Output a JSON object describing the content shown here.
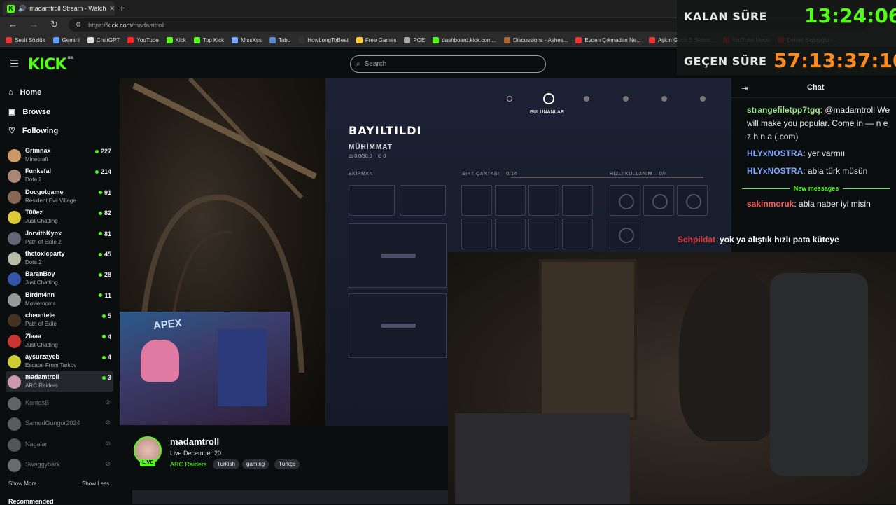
{
  "browser": {
    "tab_title": "madamtroll Stream - Watch",
    "url_prefix": "https://",
    "url_host": "kick.com",
    "url_path": "/madamtroll",
    "bookmarks": [
      {
        "label": "Sesli Sözlük",
        "color": "#e33"
      },
      {
        "label": "Gemini",
        "color": "#5b9cff"
      },
      {
        "label": "ChatGPT",
        "color": "#ddd"
      },
      {
        "label": "YouTube",
        "color": "#f22"
      },
      {
        "label": "Kick",
        "color": "#53fc18"
      },
      {
        "label": "Top Kick",
        "color": "#53fc18"
      },
      {
        "label": "MissXss",
        "color": "#7af"
      },
      {
        "label": "Tabu",
        "color": "#58c"
      },
      {
        "label": "HowLongToBeat",
        "color": "#333"
      },
      {
        "label": "Free Games",
        "color": "#fc3"
      },
      {
        "label": "POE",
        "color": "#aaa"
      },
      {
        "label": "dashboard.kick.com...",
        "color": "#53fc18"
      },
      {
        "label": "Discussions - Ashes...",
        "color": "#a63"
      },
      {
        "label": "Evden Çıkmadan Ne...",
        "color": "#e33"
      },
      {
        "label": "Aşkın Gücü 3. Sezon...",
        "color": "#e33"
      },
      {
        "label": "YouTube Music",
        "color": "#f22"
      },
      {
        "label": "Demet Sağıroğlu -...",
        "color": "#f22"
      }
    ]
  },
  "kick": {
    "logo": "KICK",
    "logo_sup": "BETA",
    "search_placeholder": "Search",
    "nav": {
      "home": "Home",
      "browse": "Browse",
      "following": "Following"
    },
    "channels": [
      {
        "name": "Grimnax",
        "game": "Minecraft",
        "viewers": "227",
        "color": "#c96"
      },
      {
        "name": "Funkefal",
        "game": "Dota 2",
        "viewers": "214",
        "color": "#a87"
      },
      {
        "name": "Docgotgame",
        "game": "Resident Evil Village",
        "viewers": "91",
        "color": "#865"
      },
      {
        "name": "T00ez",
        "game": "Just Chatting",
        "viewers": "82",
        "color": "#dc3"
      },
      {
        "name": "JorvithKynx",
        "game": "Path of Exile 2",
        "viewers": "81",
        "color": "#667"
      },
      {
        "name": "thetoxicparty",
        "game": "Dota 2",
        "viewers": "45",
        "color": "#bba"
      },
      {
        "name": "BaranBoy",
        "game": "Just Chatting",
        "viewers": "28",
        "color": "#35a"
      },
      {
        "name": "Birdm4nn",
        "game": "Movierooms",
        "viewers": "11",
        "color": "#999"
      },
      {
        "name": "cheontele",
        "game": "Path of Exile",
        "viewers": "5",
        "color": "#432"
      },
      {
        "name": "Zlaaa",
        "game": "Just Chatting",
        "viewers": "4",
        "color": "#c33"
      },
      {
        "name": "aysurzayeb",
        "game": "Escape From Tarkov",
        "viewers": "4",
        "color": "#cc3"
      },
      {
        "name": "madamtroll",
        "game": "ARC Raiders",
        "viewers": "3",
        "color": "#c9a"
      }
    ],
    "offline_channels": [
      {
        "name": "KontesB",
        "color": "#ccc"
      },
      {
        "name": "SamedGungor2024",
        "color": "#bbb"
      },
      {
        "name": "Nagalar",
        "color": "#aaa"
      },
      {
        "name": "Swaggybark",
        "color": "#ddd"
      }
    ],
    "show_more": "Show More",
    "show_less": "Show Less",
    "recommended": "Recommended",
    "streamer": {
      "name": "madamtroll",
      "live_since": "Live December 20",
      "category": "ARC Raiders",
      "tags": [
        "Turkish",
        "gaming",
        "Türkçe"
      ],
      "live_badge": "LIVE"
    },
    "chat": {
      "title": "Chat",
      "messages": [
        {
          "user": "strangefiletpp7tgq",
          "user_color": "#9be48a",
          "text": "@madamtroll We will make you popular. Come in — n e z h n a (.com)"
        },
        {
          "user": "HLYxNOSTRA",
          "user_color": "#7fa6ff",
          "text": "yer varmıı"
        },
        {
          "user": "HLYxNOSTRA",
          "user_color": "#7fa6ff",
          "text": "abla türk müsün"
        },
        {
          "user": "sakinmoruk",
          "user_color": "#ff5858",
          "text": "abla naber iyi misin"
        }
      ],
      "new_messages": "New messages"
    }
  },
  "game": {
    "tab_label": "BULUNANLAR",
    "status": "BAYILTILDI",
    "ammo_label": "MÜHİMMAT",
    "ammo_value": "0.0/30.0",
    "ammo_count": "0",
    "equipment": "EKİPMAN",
    "backpack": "SIRT ÇANTASI",
    "backpack_count": "0/14",
    "quick_use": "HIZLI KULLANIM",
    "quick_count": "0/4",
    "webcam_sign": "APEX"
  },
  "overlay": {
    "remaining_label": "KALAN SÜRE",
    "remaining_value": "13:24:06",
    "remaining_color": "#53fc18",
    "elapsed_label": "GEÇEN SÜRE",
    "elapsed_value": "57:13:37:10",
    "elapsed_color": "#ff8a1e",
    "chat_user": "Schpildat",
    "chat_text": "yok ya alıştık hızlı pata küteye"
  }
}
